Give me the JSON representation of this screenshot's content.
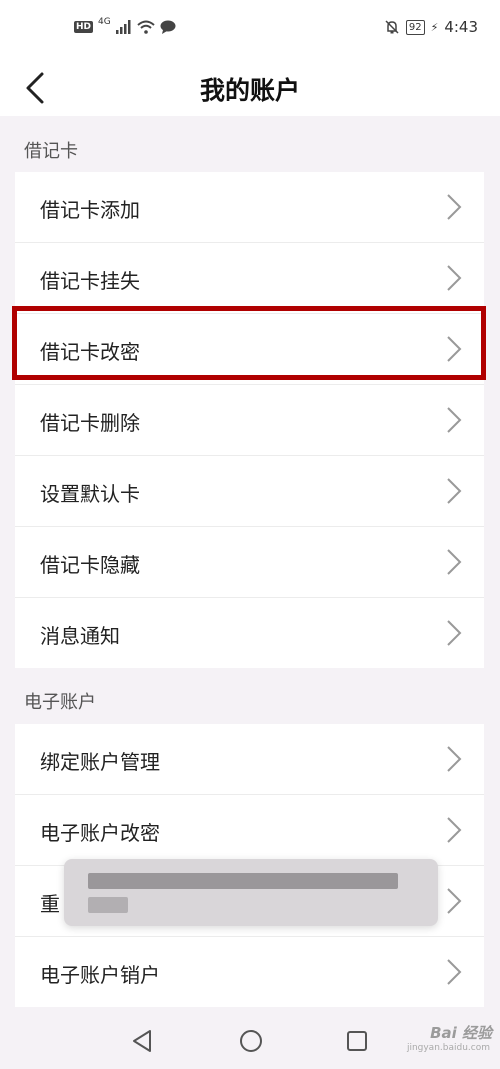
{
  "status_bar": {
    "hd": "HD",
    "network": "4G",
    "battery": "92",
    "time": "4:43",
    "icons": [
      "signal-icon",
      "wifi-icon",
      "message-icon",
      "mute-bell-icon",
      "battery-icon",
      "charging-icon"
    ]
  },
  "header": {
    "title": "我的账户",
    "back_icon": "back-arrow-icon"
  },
  "sections": [
    {
      "title": "借记卡",
      "items": [
        "借记卡添加",
        "借记卡挂失",
        "借记卡改密",
        "借记卡删除",
        "设置默认卡",
        "借记卡隐藏",
        "消息通知"
      ]
    },
    {
      "title": "电子账户",
      "items": [
        "绑定账户管理",
        "电子账户改密",
        "重",
        "电子账户销户"
      ]
    }
  ],
  "highlighted_item": "借记卡改密",
  "highlight_color": "#b00000",
  "bottom_nav": [
    "back-triangle-icon",
    "home-circle-icon",
    "recents-square-icon"
  ],
  "watermark": {
    "text": "Bai 经验",
    "sub": "jingyan.baidu.com"
  }
}
